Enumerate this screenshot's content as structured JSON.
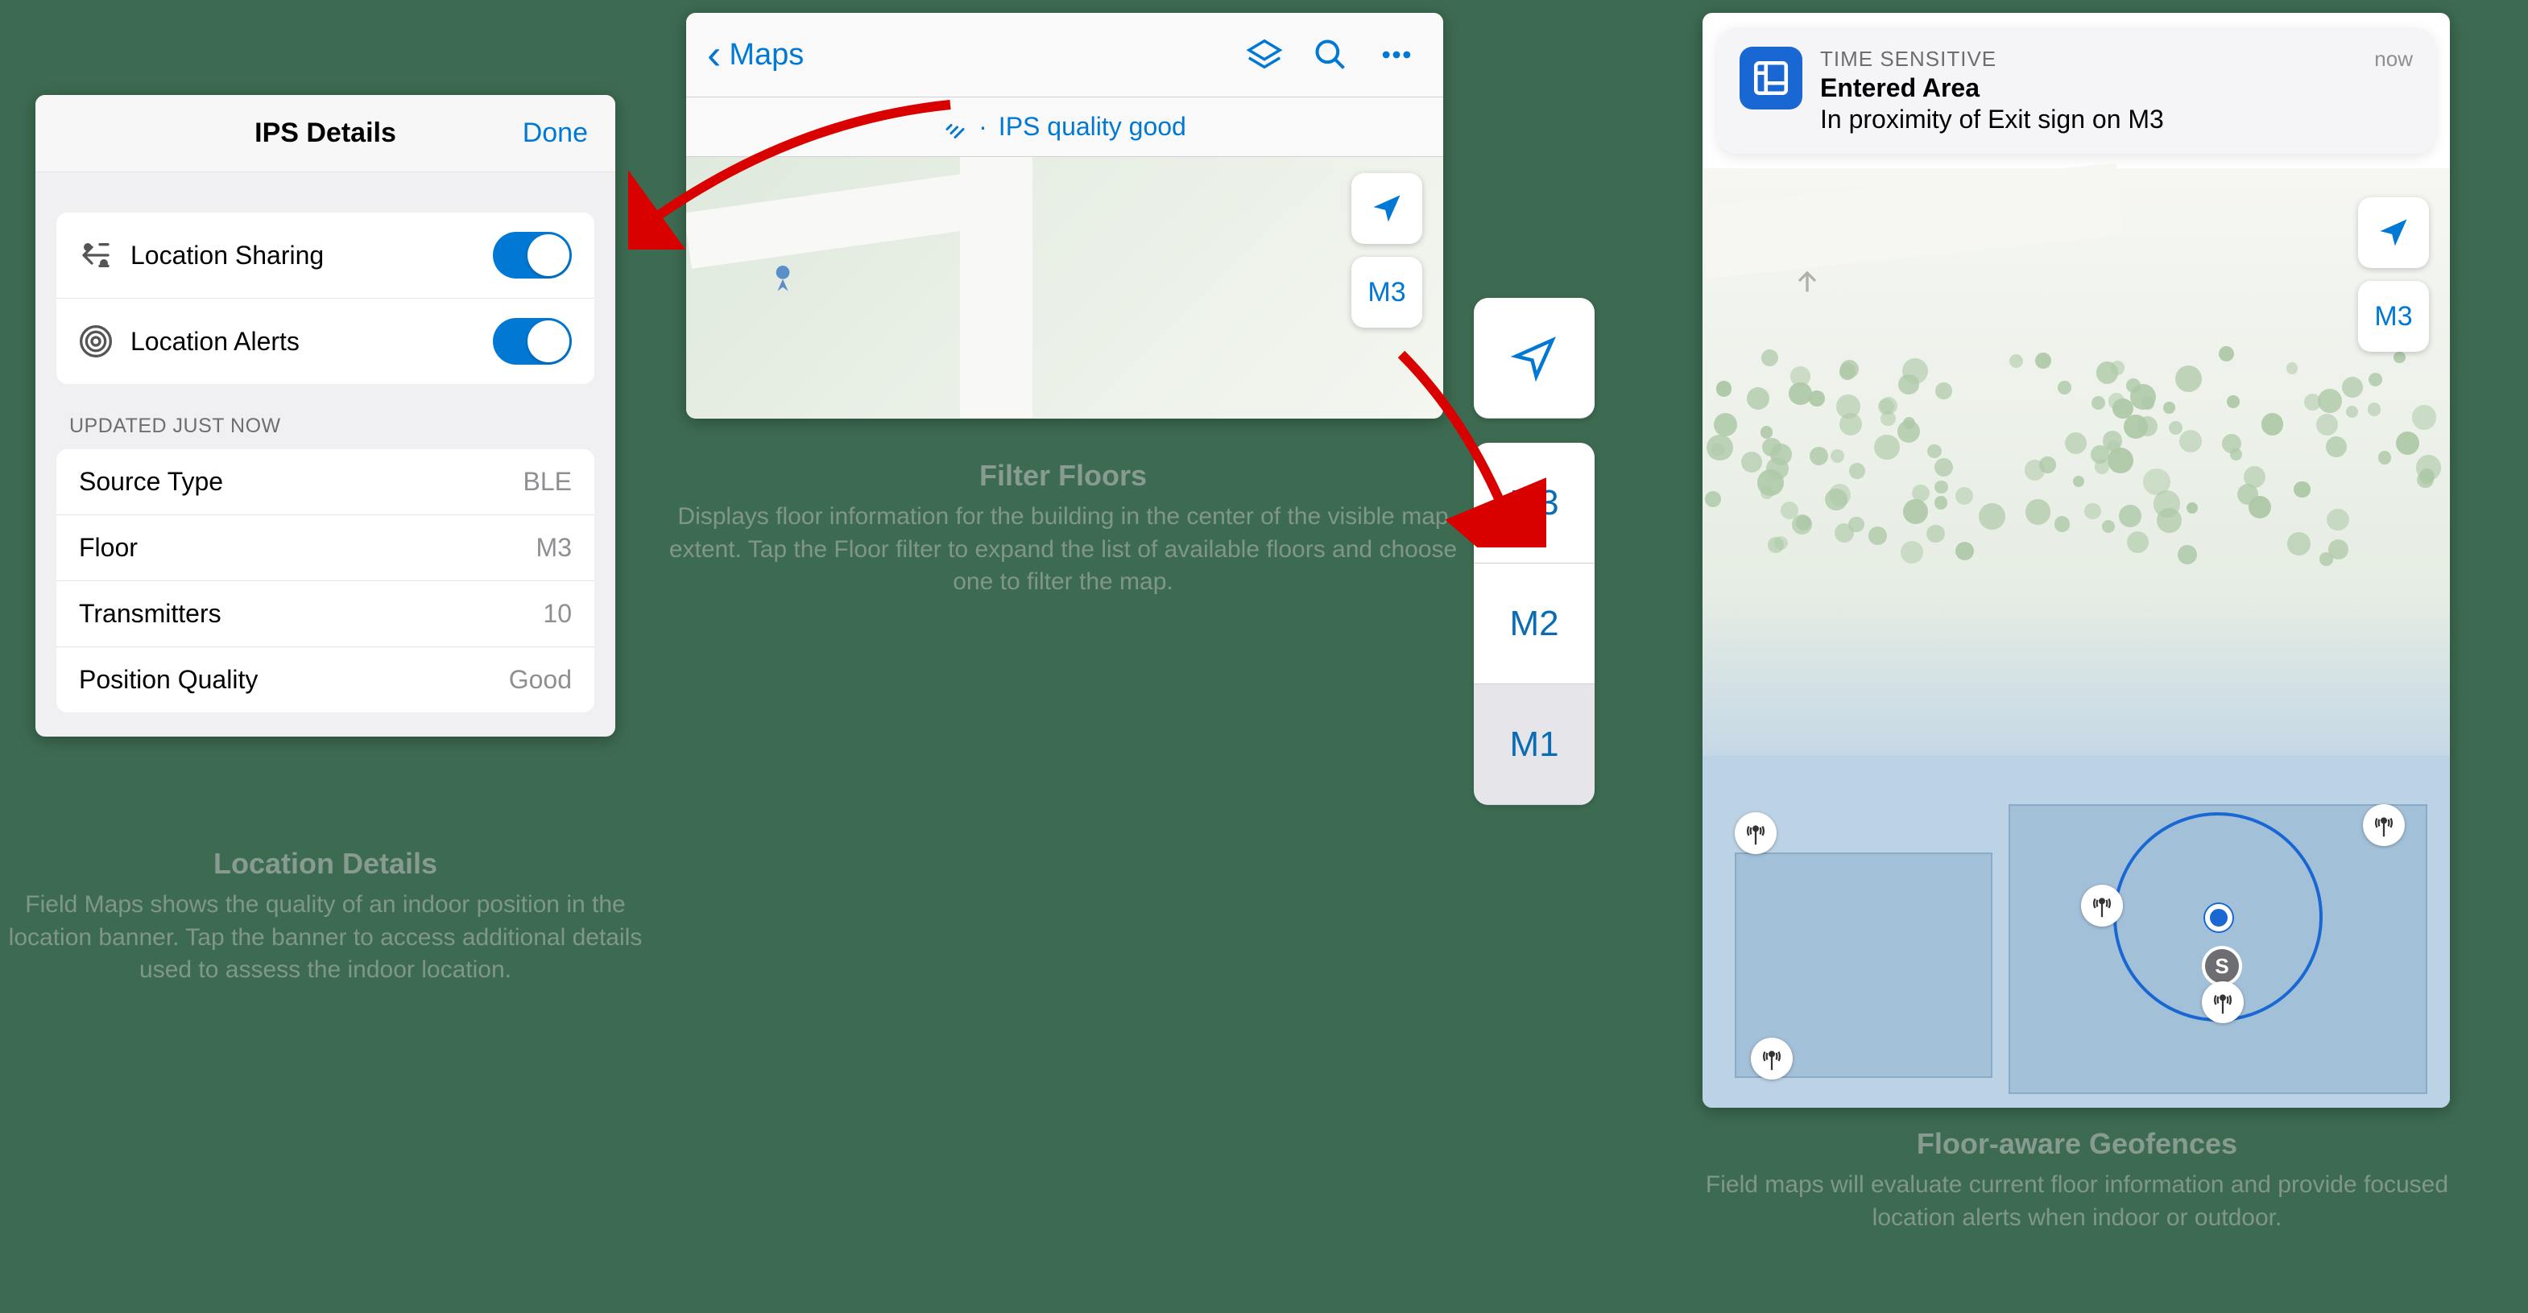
{
  "ips_panel": {
    "title": "IPS Details",
    "done": "Done",
    "toggles": [
      {
        "icon": "sharing",
        "label": "Location Sharing",
        "on": true
      },
      {
        "icon": "alerts",
        "label": "Location Alerts",
        "on": true
      }
    ],
    "updated_label": "UPDATED JUST NOW",
    "details": [
      {
        "key": "Source Type",
        "value": "BLE"
      },
      {
        "key": "Floor",
        "value": "M3"
      },
      {
        "key": "Transmitters",
        "value": "10"
      },
      {
        "key": "Position Quality",
        "value": "Good"
      }
    ]
  },
  "caption_location": {
    "title": "Location Details",
    "body": "Field Maps shows the quality of an indoor position in the location banner. Tap the banner to access additional details used to assess the indoor location."
  },
  "maps_panel": {
    "back_label": "Maps",
    "quality_text": "IPS quality good",
    "floor_button": "M3"
  },
  "caption_filter": {
    "title": "Filter Floors",
    "body": "Displays floor information for the building in the center of the visible map extent. Tap the Floor filter to expand the list of available floors and choose one to filter the map."
  },
  "floor_picker": {
    "floors": [
      "M3",
      "M2",
      "M1"
    ]
  },
  "geo_panel": {
    "notif": {
      "time_sensitive": "TIME SENSITIVE",
      "now": "now",
      "title": "Entered Area",
      "subtitle": "In proximity of Exit sign on M3"
    },
    "floor_button": "M3",
    "s_marker": "S"
  },
  "caption_geofence": {
    "title": "Floor-aware Geofences",
    "body": "Field maps will evaluate current floor information and provide focused location alerts when indoor or outdoor."
  }
}
